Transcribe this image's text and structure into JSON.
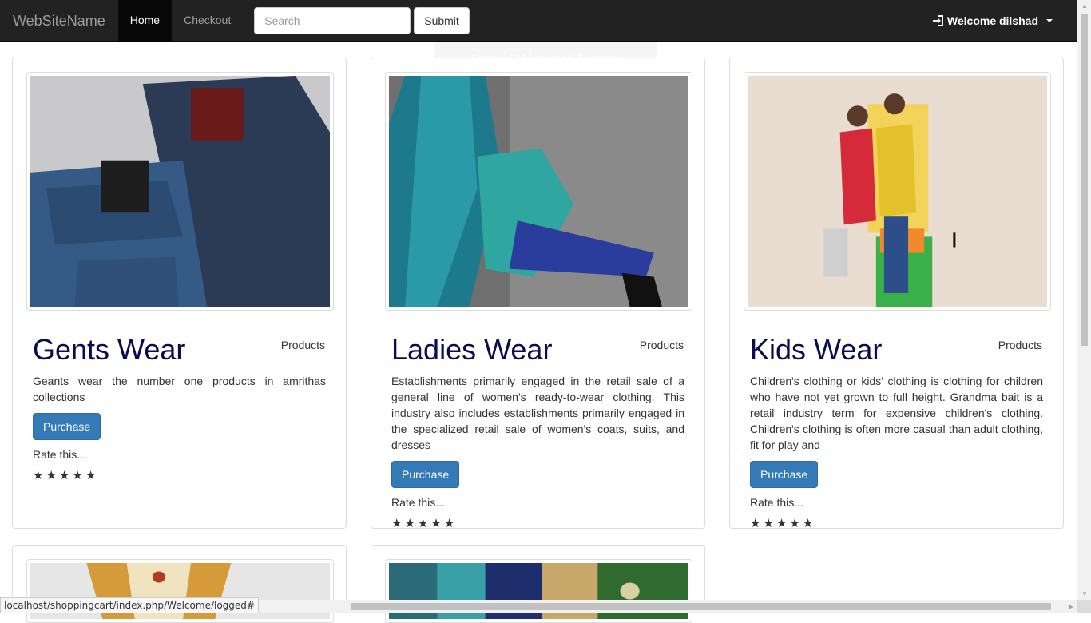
{
  "navbar": {
    "brand": "WebSiteName",
    "links": [
      {
        "label": "Home",
        "active": true
      },
      {
        "label": "Checkout",
        "active": false
      }
    ],
    "search_placeholder": "Search",
    "submit_label": "Submit",
    "user_label": "Welcome dilshad"
  },
  "fullscreen_notice": {
    "before": "Press",
    "key": "F11",
    "after": "to exit full screen"
  },
  "products": [
    {
      "title": "Gents Wear",
      "category": "Products",
      "description": "Geants wear the number one products in amrithas collections",
      "button": "Purchase",
      "rate_label": "Rate this...",
      "stars": 5
    },
    {
      "title": "Ladies Wear",
      "category": "Products",
      "description": "Establishments primarily engaged in the retail sale of a general line of women's ready-to-wear clothing. This industry also includes establishments primarily engaged in the specialized retail sale of women's coats, suits, and dresses",
      "button": "Purchase",
      "rate_label": "Rate this...",
      "stars": 5
    },
    {
      "title": "Kids Wear",
      "category": "Products",
      "description": "Children's clothing or kids' clothing is clothing for children who have not yet grown to full height. Grandma bait is a retail industry term for expensive children's clothing. Children's clothing is often more casual than adult clothing, fit for play and",
      "button": "Purchase",
      "rate_label": "Rate this...",
      "stars": 5
    }
  ],
  "status_url": "localhost/shoppingcart/index.php/Welcome/logged#",
  "colors": {
    "navbar_bg": "#222222",
    "title_color": "#0b0b4f",
    "button_primary": "#337ab7"
  }
}
